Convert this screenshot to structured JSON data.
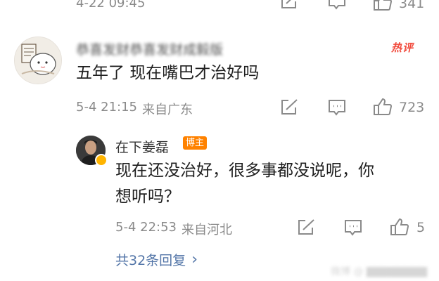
{
  "top_row": {
    "timestamp": "4-22 09:45",
    "like_count": "341"
  },
  "comment": {
    "username": "恭喜发财恭喜发财成毅版",
    "hot_badge": "热评",
    "text": "五年了 现在嘴巴才治好吗",
    "timestamp": "5-4 21:15",
    "location": "来自广东",
    "like_count": "723"
  },
  "reply": {
    "username": "在下姜磊",
    "author_badge": "博主",
    "text_line1": "现在还没治好，很多事都没说呢，你",
    "text_line2": "想听吗？",
    "timestamp": "5-4 22:53",
    "location": "来自河北",
    "like_count": "5"
  },
  "view_replies": {
    "label": "共32条回复",
    "chevron": "›"
  },
  "watermark": "微博 @ ▇▇▇▇▇▇▇▇",
  "colors": {
    "meta_gray": "#8a8a8a",
    "hot_red": "#f1483a",
    "author_orange": "#ff8200",
    "link_blue": "#5476a8"
  },
  "icons": {
    "share": "share-icon",
    "comment": "comment-icon",
    "like": "thumbs-up-icon",
    "chevron": "chevron-right-icon"
  }
}
